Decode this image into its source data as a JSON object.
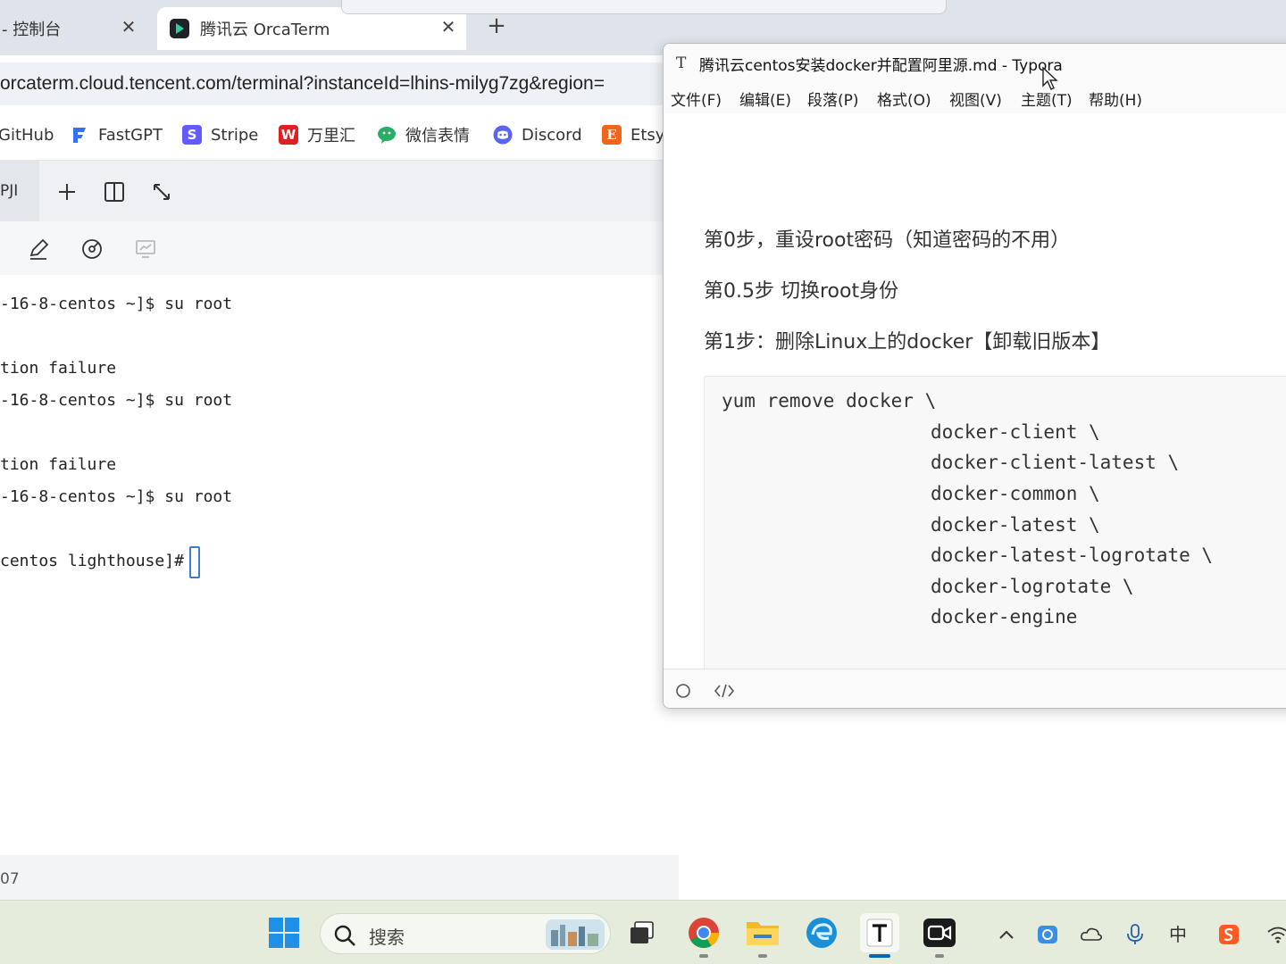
{
  "browser": {
    "tabs": [
      {
        "label": "- 控制台"
      },
      {
        "label": "腾讯云 OrcaTerm"
      }
    ],
    "tab_close_symbol": "✕",
    "new_tab_symbol": "+",
    "url": "orcaterm.cloud.tencent.com/terminal?instanceId=lhins-milyg7zg&region="
  },
  "bookmarks": [
    {
      "label": "GitHub",
      "icon": "github-icon"
    },
    {
      "label": "FastGPT",
      "icon": "fastgpt-icon",
      "color": "#3370ff"
    },
    {
      "label": "Stripe",
      "icon": "stripe-icon",
      "color": "#635bff",
      "glyph": "S"
    },
    {
      "label": "万里汇",
      "icon": "worldfirst-icon",
      "color": "#e02020",
      "glyph": "W"
    },
    {
      "label": "微信表情",
      "icon": "wechat-icon",
      "color": "#2aae67"
    },
    {
      "label": "Discord",
      "icon": "discord-icon",
      "color": "#5865f2"
    },
    {
      "label": "Etsy",
      "icon": "etsy-icon",
      "color": "#f1641e",
      "glyph": "E"
    }
  ],
  "orcaterm": {
    "session_tab_label": "PJI",
    "status_text": "07"
  },
  "terminal": {
    "lines": [
      "-16-8-centos ~]$ su root",
      "tion failure",
      "-16-8-centos ~]$ su root",
      "tion failure",
      "-16-8-centos ~]$ su root",
      "centos lighthouse]# "
    ]
  },
  "typora": {
    "title": "腾讯云centos安装docker并配置阿里源.md - Typora",
    "logo_glyph": "T",
    "menu": [
      "文件(F)",
      "编辑(E)",
      "段落(P)",
      "格式(O)",
      "视图(V)",
      "主题(T)",
      "帮助(H)"
    ],
    "paragraphs": [
      "第0步，重设root密码（知道密码的不用）",
      "第0.5步 切换root身份",
      "第1步：删除Linux上的docker【卸载旧版本】"
    ],
    "code_lines": [
      "yum remove docker \\",
      "docker-client \\",
      "docker-client-latest \\",
      "docker-common \\",
      "docker-latest \\",
      "docker-latest-logrotate \\",
      "docker-logrotate \\",
      "docker-engine"
    ]
  },
  "taskbar": {
    "search_placeholder": "搜索",
    "ime_label": "中"
  },
  "colors": {
    "terminal_cursor": "#3a7bd5",
    "taskbar_bg": "#e5ecdc",
    "active_indicator": "#0067c0"
  }
}
